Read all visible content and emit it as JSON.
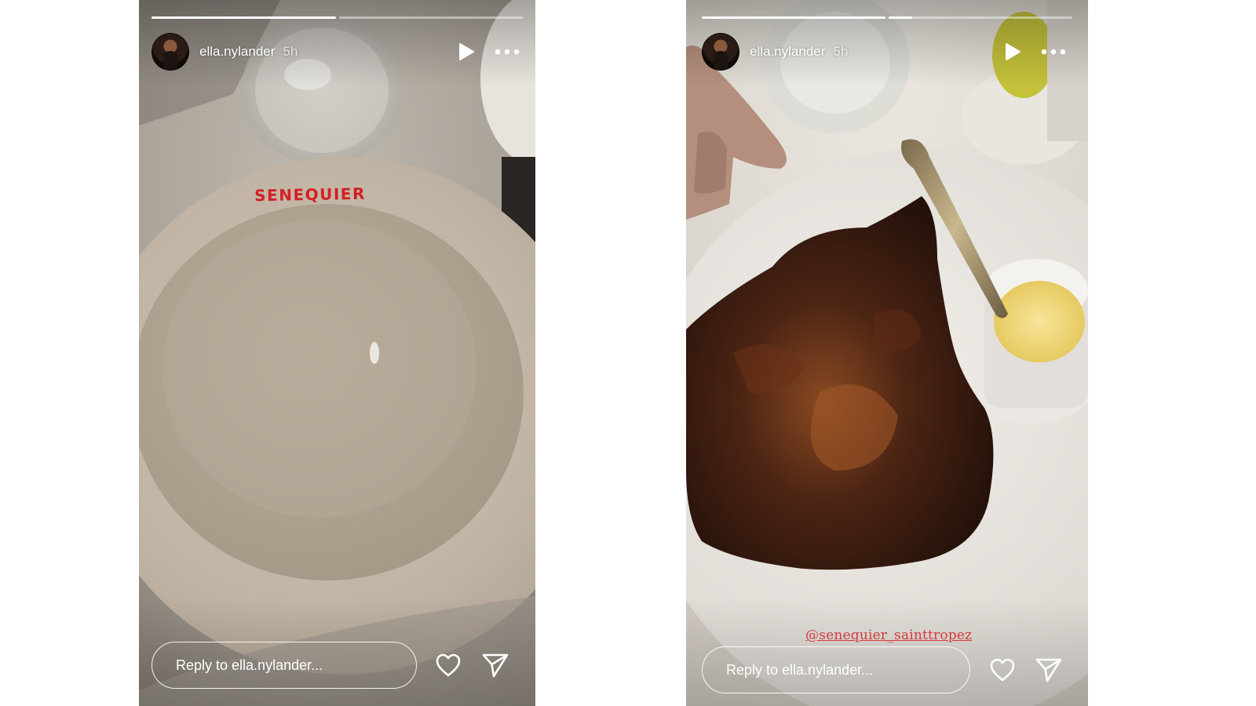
{
  "stories": [
    {
      "progress": [
        1.0,
        0.0
      ],
      "username": "ella.nylander",
      "time": "5h",
      "plate_brand": "SENEQUIER",
      "reply_placeholder": "Reply to ella.nylander..."
    },
    {
      "progress": [
        1.0,
        0.13
      ],
      "username": "ella.nylander",
      "time": "5h",
      "mention": "@senequier_sainttropez",
      "reply_placeholder": "Reply to ella.nylander..."
    }
  ],
  "icons": {
    "play": "play-icon",
    "more": "more-icon",
    "like": "heart-icon",
    "share": "send-icon"
  },
  "colors": {
    "brand_red": "#d41f23",
    "mention_red": "#d63a3a"
  }
}
